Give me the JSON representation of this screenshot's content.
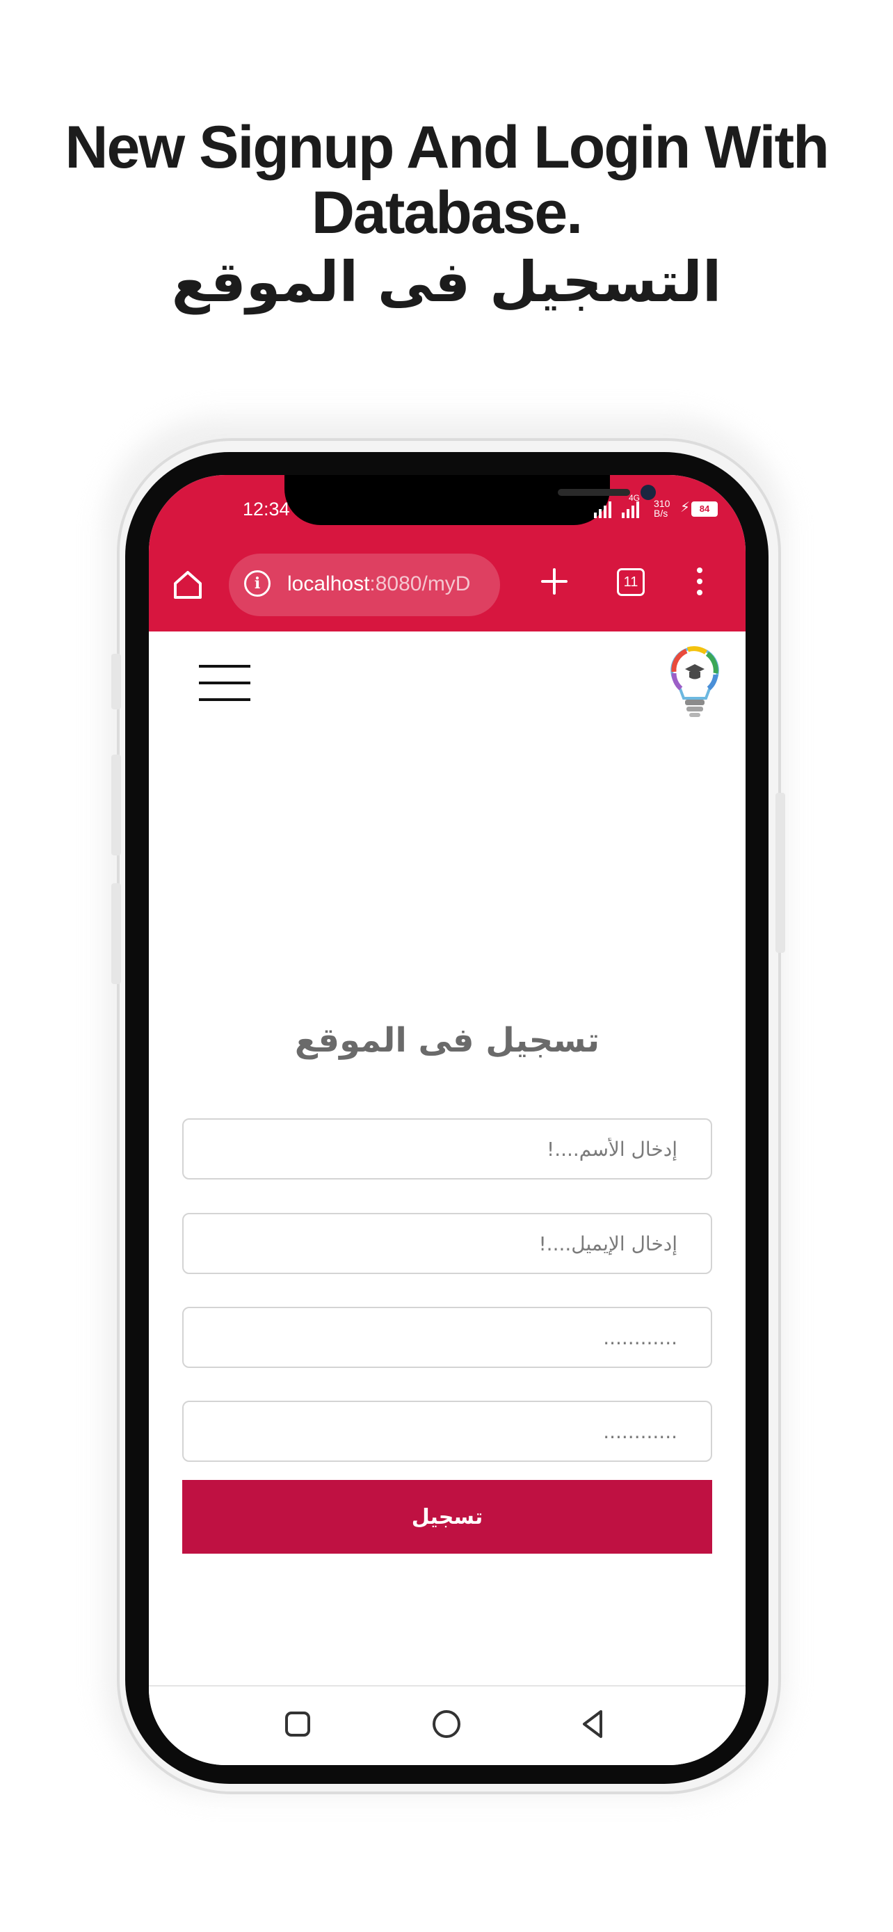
{
  "headline": {
    "line1": "New Signup And Login With",
    "line2": "Database.",
    "line3": "التسجيل فى الموقع"
  },
  "status_bar": {
    "time": "12:34",
    "network": "4G",
    "speed_value": "310",
    "speed_unit": "B/s",
    "battery": "84"
  },
  "browser": {
    "url_host": "localhost",
    "url_rest": ":8080/myD",
    "tab_count": "11",
    "accent": "#d7163f"
  },
  "icons": [
    "home-icon",
    "info-icon",
    "plus-icon",
    "tabs-icon",
    "more-vert-icon",
    "hamburger-menu-icon",
    "lightbulb-logo-icon",
    "square-nav-icon",
    "circle-home-nav-icon",
    "back-triangle-icon"
  ],
  "form": {
    "title": "تسجيل فى الموقع",
    "name_placeholder": "إدخال الأسم....!",
    "email_placeholder": "إدخال الإيميل....!",
    "password_placeholder": "............",
    "confirm_password_placeholder": "............",
    "submit_label": "تسجيل",
    "button_color": "#bf1142"
  }
}
